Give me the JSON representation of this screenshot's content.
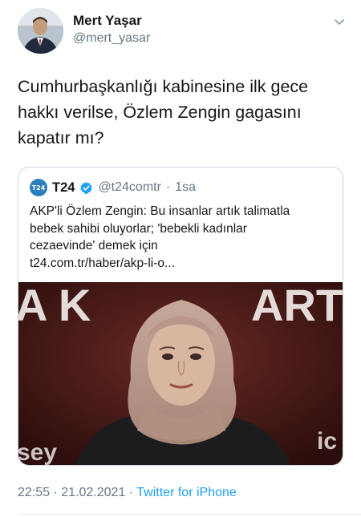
{
  "author": {
    "name": "Mert Yaşar",
    "handle": "@mert_yasar",
    "avatar_icon": "person-photo-avatar"
  },
  "tweet": {
    "text_lines": [
      "Cumhurbaşkanlığı kabinesine ilk gece",
      "hakkı verilse, Özlem Zengin gagasını",
      "kapatır mı?"
    ]
  },
  "quoted": {
    "logo_text": "T24",
    "name": "T24",
    "handle": "@t24comtr",
    "separator": "·",
    "time": "1sa",
    "text_lines": [
      "AKP'li Özlem Zengin: Bu insanlar artık talimatla",
      "bebek sahibi oluyorlar; 'bebekli kadınlar",
      "cezaevinde' demek için",
      "t24.com.tr/haber/akp-li-o..."
    ],
    "image_caption_letters": "AK PARTİ",
    "image_lower_letters": "sey                                     ic"
  },
  "meta": {
    "time": "22:55",
    "dot1": " · ",
    "date": "21.02.2021",
    "dot2": " · ",
    "source": "Twitter for iPhone"
  },
  "colors": {
    "text": "#14171a",
    "secondary": "#657786",
    "link": "#1da1f2",
    "border": "#ccd6dd"
  }
}
